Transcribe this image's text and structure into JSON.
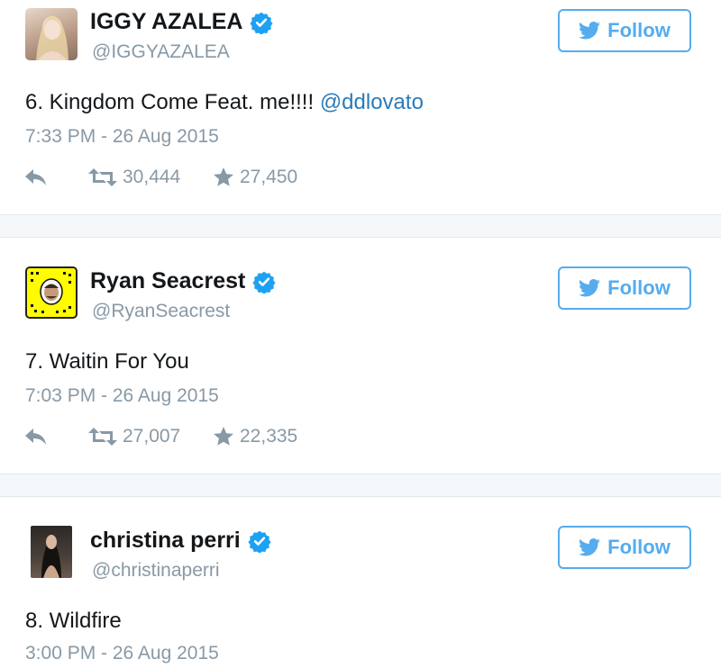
{
  "tweets": [
    {
      "display_name": "IGGY AZALEA",
      "handle": "@IGGYAZALEA",
      "follow_label": "Follow",
      "text": "6. Kingdom Come Feat. me!!!! ",
      "mention": "@ddlovato",
      "timestamp": "7:33 PM - 26 Aug 2015",
      "retweets": "30,444",
      "favorites": "27,450"
    },
    {
      "display_name": "Ryan Seacrest",
      "handle": "@RyanSeacrest",
      "follow_label": "Follow",
      "text": "7. Waitin For You",
      "timestamp": "7:03 PM - 26 Aug 2015",
      "retweets": "27,007",
      "favorites": "22,335"
    },
    {
      "display_name": "christina perri",
      "handle": "@christinaperri",
      "follow_label": "Follow",
      "text": "8. Wildfire",
      "timestamp": "3:00 PM - 26 Aug 2015"
    }
  ],
  "colors": {
    "twitter_blue": "#55acee",
    "mention_blue": "#2b7bb9",
    "muted_gray": "#8899a6",
    "verified_blue": "#1da1f2"
  },
  "icons": [
    "verified-badge-icon",
    "twitter-bird-icon",
    "reply-icon",
    "retweet-icon",
    "star-icon"
  ]
}
